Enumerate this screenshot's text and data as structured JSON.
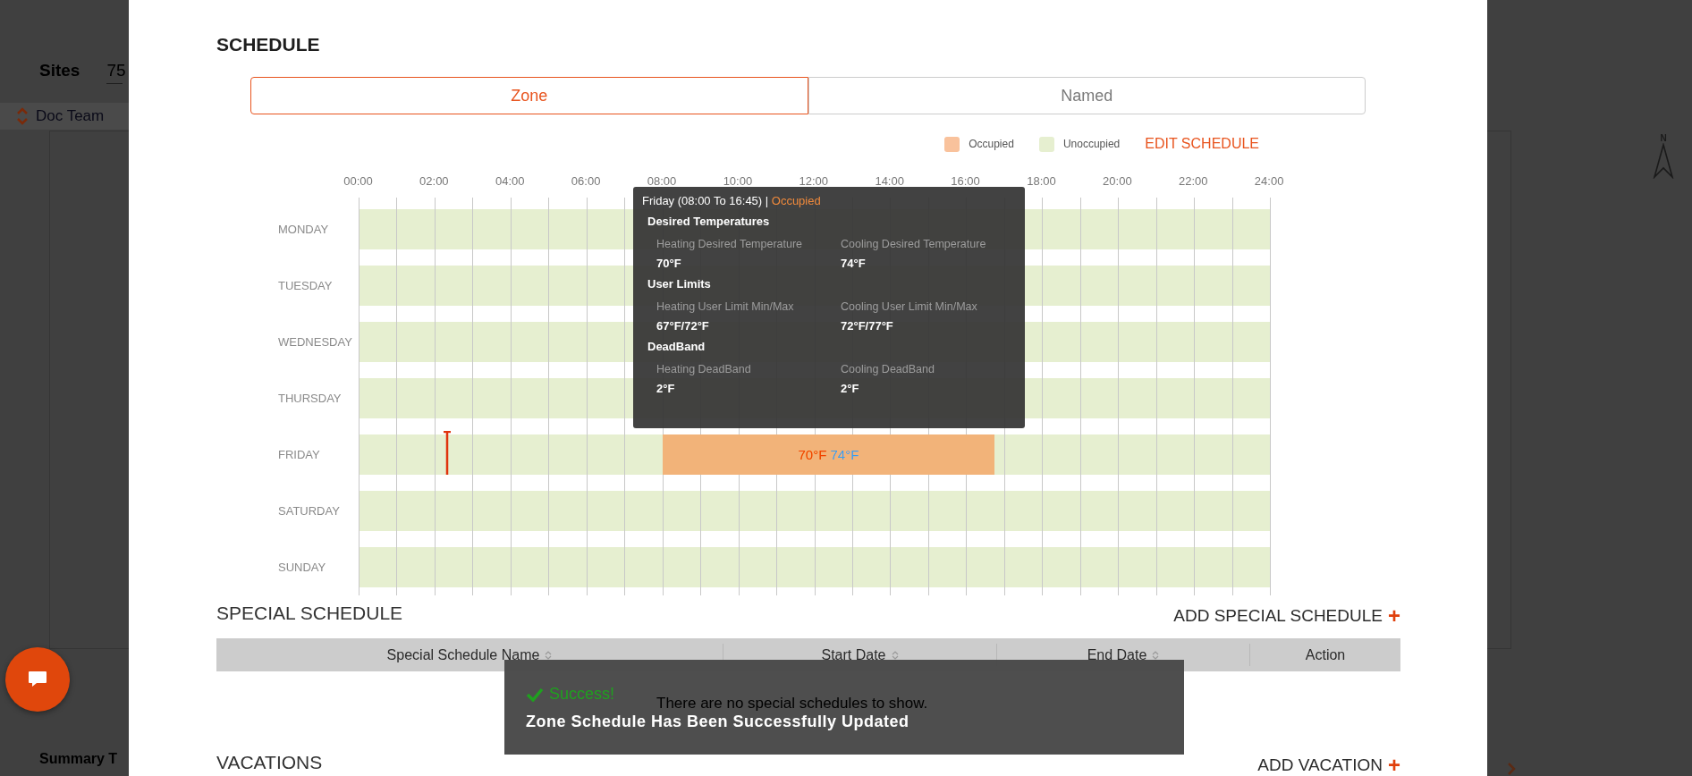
{
  "background": {
    "sites_label": "Sites",
    "sites_value": "75",
    "site_row": "Doc Team",
    "summary_label": "Summary T",
    "compass_label": "N"
  },
  "schedule": {
    "title": "SCHEDULE",
    "tabs": [
      {
        "label": "Zone",
        "selected": true
      },
      {
        "label": "Named",
        "selected": false
      }
    ],
    "legend": [
      {
        "label": "Occupied",
        "color": "#f9c29c"
      },
      {
        "label": "Unoccupied",
        "color": "#e6efd0"
      }
    ],
    "edit_link": "EDIT SCHEDULE",
    "time_labels": [
      "00:00",
      "02:00",
      "04:00",
      "06:00",
      "08:00",
      "10:00",
      "12:00",
      "14:00",
      "16:00",
      "18:00",
      "20:00",
      "22:00",
      "24:00"
    ],
    "days": [
      {
        "label": "MONDAY"
      },
      {
        "label": "TUESDAY"
      },
      {
        "label": "WEDNESDAY"
      },
      {
        "label": "THURSDAY"
      },
      {
        "label": "FRIDAY",
        "now_marker": true,
        "blocks": [
          {
            "start": "08:00",
            "end": "16:45",
            "heating": "70°F",
            "cooling": "74°F",
            "tooltip": {
              "day": "Friday (",
              "to": "To",
              "close": ") |",
              "status": "Occupied",
              "sections": [
                {
                  "heading": "Desired Temperatures",
                  "items": [
                    {
                      "label": "Heating Desired Temperature",
                      "value": "70°F"
                    },
                    {
                      "label": "Cooling Desired Temperature",
                      "value": "74°F"
                    }
                  ]
                },
                {
                  "heading": "User Limits",
                  "items": [
                    {
                      "label": "Heating User Limit Min/Max",
                      "value": "67°F/72°F"
                    },
                    {
                      "label": "Cooling User Limit Min/Max",
                      "value": "72°F/77°F"
                    }
                  ]
                },
                {
                  "heading": "DeadBand",
                  "items": [
                    {
                      "label": "Heating DeadBand",
                      "value": "2°F"
                    },
                    {
                      "label": "Cooling DeadBand",
                      "value": "2°F"
                    }
                  ]
                }
              ]
            }
          }
        ]
      },
      {
        "label": "SATURDAY"
      },
      {
        "label": "SUNDAY"
      }
    ]
  },
  "special_schedule": {
    "title": "SPECIAL SCHEDULE",
    "add_link": "ADD SPECIAL SCHEDULE",
    "add_icon": "+",
    "columns": [
      {
        "label": "Special Schedule Name",
        "sortable": true
      },
      {
        "label": "Start Date",
        "sortable": true
      },
      {
        "label": "End Date",
        "sortable": true
      },
      {
        "label": "Action",
        "sortable": false
      }
    ],
    "empty_message": "There are no special schedules to show."
  },
  "vacations": {
    "title": "VACATIONS",
    "add_link": "ADD VACATION",
    "add_icon": "+"
  },
  "toast": {
    "status": "Success!",
    "message": "Zone Schedule Has Been Successfully Updated"
  }
}
